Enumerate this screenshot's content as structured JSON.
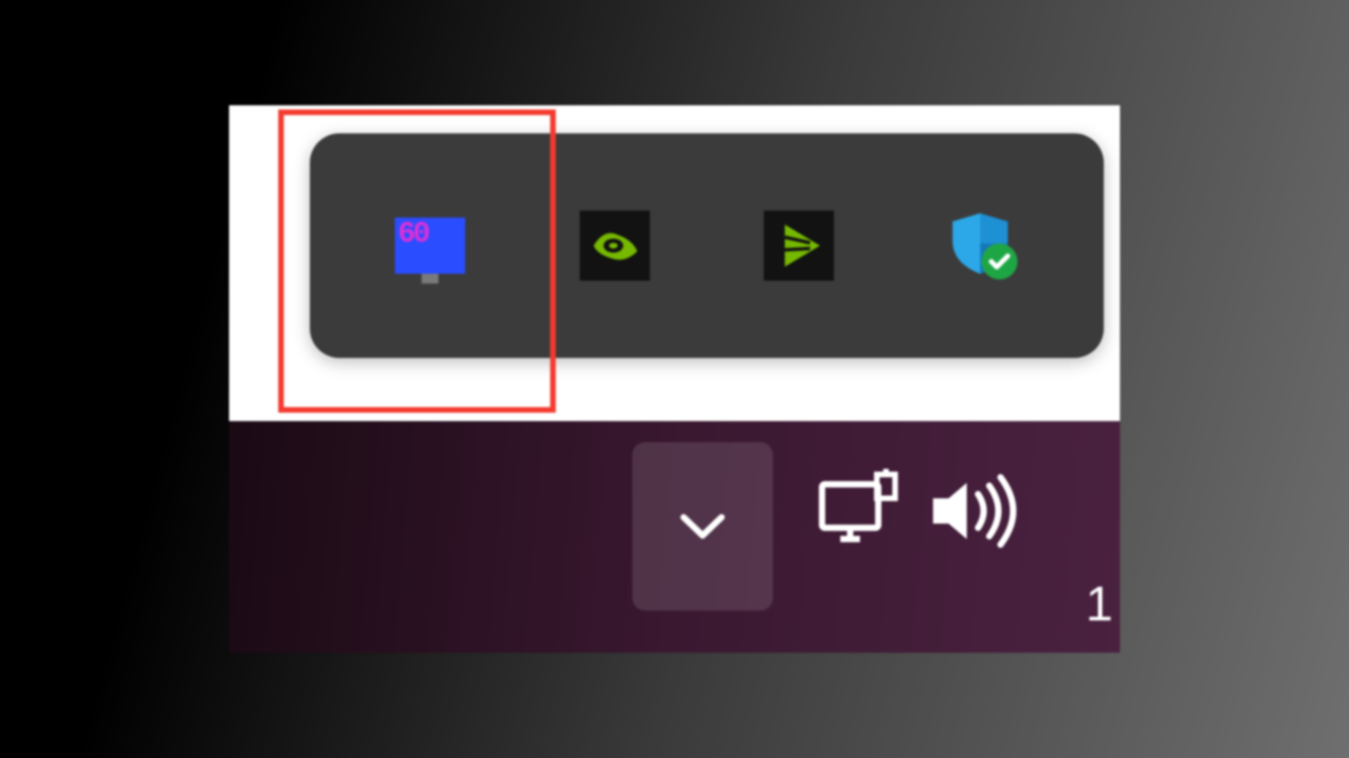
{
  "tray": {
    "fps_value": "60",
    "icons": [
      {
        "name": "fps-monitor-icon"
      },
      {
        "name": "nvidia-icon"
      },
      {
        "name": "play-media-icon"
      },
      {
        "name": "windows-security-icon"
      }
    ]
  },
  "taskbar": {
    "chevron_label": "Show hidden icons",
    "clock_fragment": "1"
  },
  "highlight": {
    "target": "fps-monitor-icon"
  },
  "colors": {
    "highlight_border": "#f43a2f",
    "tray_bg": "#3b3b3b",
    "taskbar_bg": "#3a1830",
    "nvidia_green": "#76b900",
    "security_blue": "#1e90d4",
    "security_ok": "#1fa644"
  }
}
